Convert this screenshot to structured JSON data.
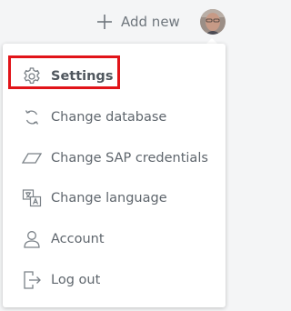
{
  "topbar": {
    "add_new_label": "Add new"
  },
  "menu": {
    "items": [
      {
        "label": "Settings",
        "icon": "gear-icon"
      },
      {
        "label": "Change database",
        "icon": "refresh-icon"
      },
      {
        "label": "Change SAP credentials",
        "icon": "parallelogram-icon"
      },
      {
        "label": "Change language",
        "icon": "translate-icon"
      },
      {
        "label": "Account",
        "icon": "user-icon"
      },
      {
        "label": "Log out",
        "icon": "logout-icon"
      }
    ]
  },
  "colors": {
    "highlight": "#e11419",
    "text": "#5f666d",
    "icon": "#7a8187"
  }
}
